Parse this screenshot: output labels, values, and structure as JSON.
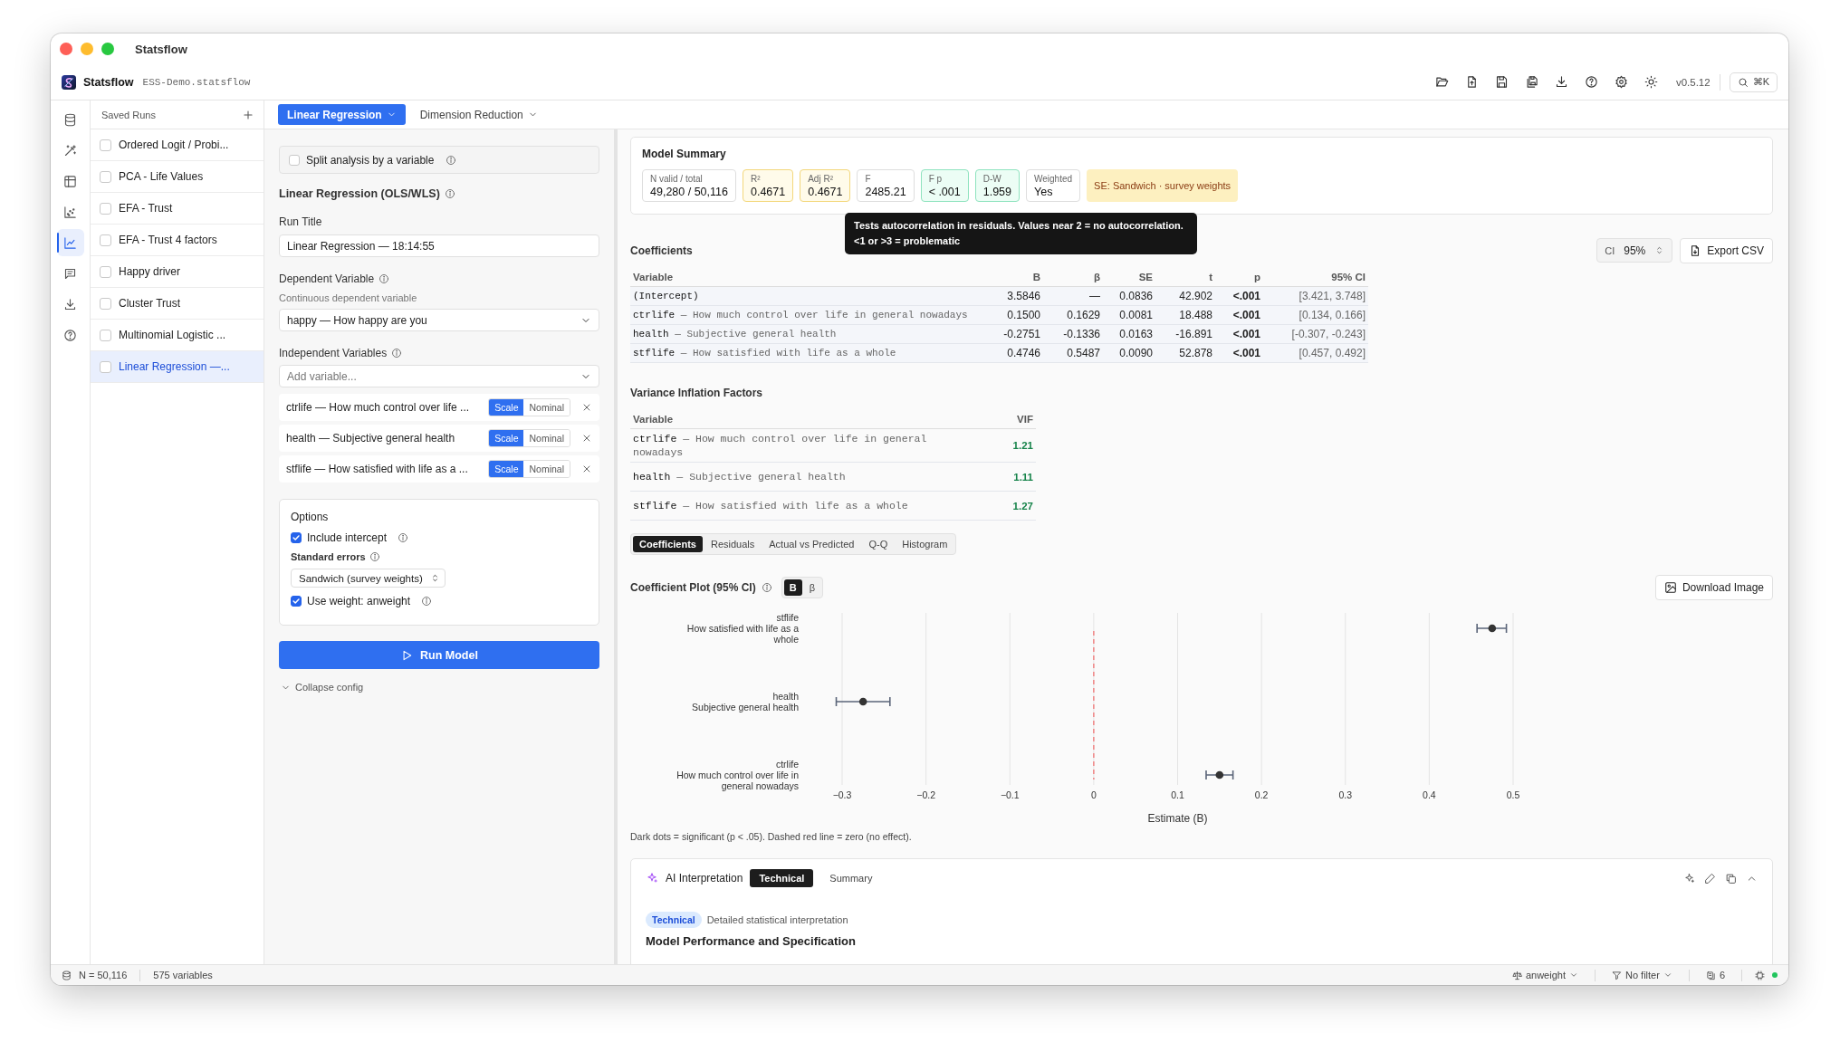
{
  "window": {
    "title": "Statsflow"
  },
  "app_header": {
    "app_name": "Statsflow",
    "file_name": "ESS-Demo.statsflow",
    "version": "v0.5.12",
    "search_shortcut": "⌘K"
  },
  "nav_rail": [
    {
      "selected": false
    },
    {
      "selected": false
    },
    {
      "selected": false
    },
    {
      "selected": false
    },
    {
      "selected": true
    },
    {
      "selected": false
    },
    {
      "selected": false
    },
    {
      "selected": false
    }
  ],
  "saved_runs": {
    "title": "Saved Runs",
    "items": [
      {
        "label": "Ordered Logit / Probi...",
        "checked": false,
        "selected": false
      },
      {
        "label": "PCA - Life Values",
        "checked": false,
        "selected": false
      },
      {
        "label": "EFA - Trust",
        "checked": false,
        "selected": false
      },
      {
        "label": "EFA - Trust 4 factors",
        "checked": false,
        "selected": false
      },
      {
        "label": "Happy driver",
        "checked": false,
        "selected": false
      },
      {
        "label": "Cluster Trust",
        "checked": false,
        "selected": false
      },
      {
        "label": "Multinomial Logistic ...",
        "checked": false,
        "selected": false
      },
      {
        "label": "Linear Regression —...",
        "checked": false,
        "selected": true
      }
    ]
  },
  "analysis_tabs": [
    {
      "label": "Linear Regression",
      "selected": true
    },
    {
      "label": "Dimension Reduction",
      "selected": false
    }
  ],
  "config": {
    "split": {
      "label": "Split analysis by a variable",
      "checked": false
    },
    "section_title": "Linear Regression (OLS/WLS)",
    "run_title": {
      "label": "Run Title",
      "value": "Linear Regression — 18:14:55"
    },
    "dependent": {
      "label": "Dependent Variable",
      "hint": "Continuous dependent variable",
      "value": "happy — How happy are you"
    },
    "independent": {
      "label": "Independent Variables",
      "placeholder": "Add variable...",
      "items": [
        {
          "label": "ctrlife — How much control over life ...",
          "measure": [
            {
              "label": "Scale",
              "selected": true
            },
            {
              "label": "Nominal",
              "selected": false
            }
          ]
        },
        {
          "label": "health — Subjective general health",
          "measure": [
            {
              "label": "Scale",
              "selected": true
            },
            {
              "label": "Nominal",
              "selected": false
            }
          ]
        },
        {
          "label": "stflife — How satisfied with life as a ...",
          "measure": [
            {
              "label": "Scale",
              "selected": true
            },
            {
              "label": "Nominal",
              "selected": false
            }
          ]
        }
      ]
    },
    "options": {
      "title": "Options",
      "include_intercept": {
        "label": "Include intercept",
        "checked": true
      },
      "standard_errors": {
        "label": "Standard errors",
        "value": "Sandwich (survey weights)"
      },
      "use_weight": {
        "label": "Use weight: anweight",
        "checked": true
      }
    },
    "run_button": "Run Model",
    "collapse": "Collapse config"
  },
  "model_summary": {
    "title": "Model Summary",
    "stats": [
      {
        "label": "N valid / total",
        "value": "49,280 / 50,116",
        "kind": "neutral"
      },
      {
        "label": "R²",
        "value": "0.4671",
        "kind": "highlight"
      },
      {
        "label": "Adj R²",
        "value": "0.4671",
        "kind": "highlight"
      },
      {
        "label": "F",
        "value": "2485.21",
        "kind": "neutral"
      },
      {
        "label": "F p",
        "value": "< .001",
        "kind": "good"
      },
      {
        "label": "D-W",
        "value": "1.959",
        "kind": "good"
      },
      {
        "label": "Weighted",
        "value": "Yes",
        "kind": "neutral"
      }
    ],
    "se_note": "SE: Sandwich · survey weights",
    "tooltip": "Tests autocorrelation in residuals. Values near 2 = no autocorrelation. <1 or >3 = problematic"
  },
  "coefficients": {
    "title": "Coefficients",
    "ci_select": {
      "label": "CI",
      "value": "95%"
    },
    "export_button": "Export CSV",
    "columns": [
      "Variable",
      "B",
      "β",
      "SE",
      "t",
      "p",
      "95% CI"
    ],
    "rows": [
      {
        "cells": [
          "(Intercept)",
          "3.5846",
          "—",
          "0.0836",
          "42.902",
          "<.001",
          "[3.421, 3.748]"
        ]
      },
      {
        "cells": [
          "ctrlife — How much control over life in general nowadays",
          "0.1500",
          "0.1629",
          "0.0081",
          "18.488",
          "<.001",
          "[0.134, 0.166]"
        ]
      },
      {
        "cells": [
          "health — Subjective general health",
          "-0.2751",
          "-0.1336",
          "0.0163",
          "-16.891",
          "<.001",
          "[-0.307, -0.243]"
        ]
      },
      {
        "cells": [
          "stflife — How satisfied with life as a whole",
          "0.4746",
          "0.5487",
          "0.0090",
          "52.878",
          "<.001",
          "[0.457, 0.492]"
        ]
      }
    ]
  },
  "vif": {
    "title": "Variance Inflation Factors",
    "columns": [
      "Variable",
      "VIF"
    ],
    "rows": [
      {
        "cells": [
          "ctrlife — How much control over life in general nowadays",
          "1.21"
        ]
      },
      {
        "cells": [
          "health — Subjective general health",
          "1.11"
        ]
      },
      {
        "cells": [
          "stflife — How satisfied with life as a whole",
          "1.27"
        ]
      }
    ]
  },
  "result_tabs": [
    {
      "label": "Coefficients",
      "selected": true
    },
    {
      "label": "Residuals",
      "selected": false
    },
    {
      "label": "Actual vs Predicted",
      "selected": false
    },
    {
      "label": "Q-Q",
      "selected": false
    },
    {
      "label": "Histogram",
      "selected": false
    }
  ],
  "coefficient_plot": {
    "title": "Coefficient Plot (95% CI)",
    "toggle": [
      {
        "label": "B",
        "selected": true
      },
      {
        "label": "β",
        "selected": false
      }
    ],
    "download_button": "Download Image",
    "chart_data": {
      "type": "scatter",
      "orientation": "horizontal",
      "xlabel": "Estimate (B)",
      "categories": [
        "stflife\nHow satisfied with life as a\nwhole",
        "health\nSubjective general health",
        "ctrlife\nHow much control over life in\ngeneral nowadays"
      ],
      "series": [
        {
          "color": "#333333",
          "values": [
            0.475,
            -0.275,
            0.15
          ],
          "errors": [
            [
              0.457,
              0.492
            ],
            [
              -0.307,
              -0.243
            ],
            [
              0.134,
              0.166
            ]
          ]
        }
      ],
      "xlim": [
        -0.3,
        0.5
      ],
      "grid": true,
      "ref_lines": [
        {
          "axis": "x",
          "value": 0,
          "color": "#f26b6b"
        }
      ],
      "xticks": [
        {
          "value": -0.3,
          "label": "−0.3"
        },
        {
          "value": -0.2,
          "label": "−0.2"
        },
        {
          "value": -0.1,
          "label": "−0.1"
        },
        {
          "value": 0,
          "label": "0"
        },
        {
          "value": 0.1,
          "label": "0.1"
        },
        {
          "value": 0.2,
          "label": "0.2"
        },
        {
          "value": 0.3,
          "label": "0.3"
        },
        {
          "value": 0.4,
          "label": "0.4"
        },
        {
          "value": 0.5,
          "label": "0.5"
        }
      ]
    },
    "footnote": "Dark dots = significant (p < .05). Dashed red line = zero (no effect)."
  },
  "ai_panel": {
    "title": "AI Interpretation",
    "tabs": [
      {
        "label": "Technical",
        "selected": true
      },
      {
        "label": "Summary",
        "selected": false
      }
    ],
    "badge": "Technical",
    "subtitle": "Detailed statistical interpretation",
    "heading": "Model Performance and Specification"
  },
  "status_bar": {
    "rows": "N = 50,116",
    "variables": "575 variables",
    "weight": "anweight",
    "filter": "No filter",
    "count": "6",
    "connected": true
  }
}
